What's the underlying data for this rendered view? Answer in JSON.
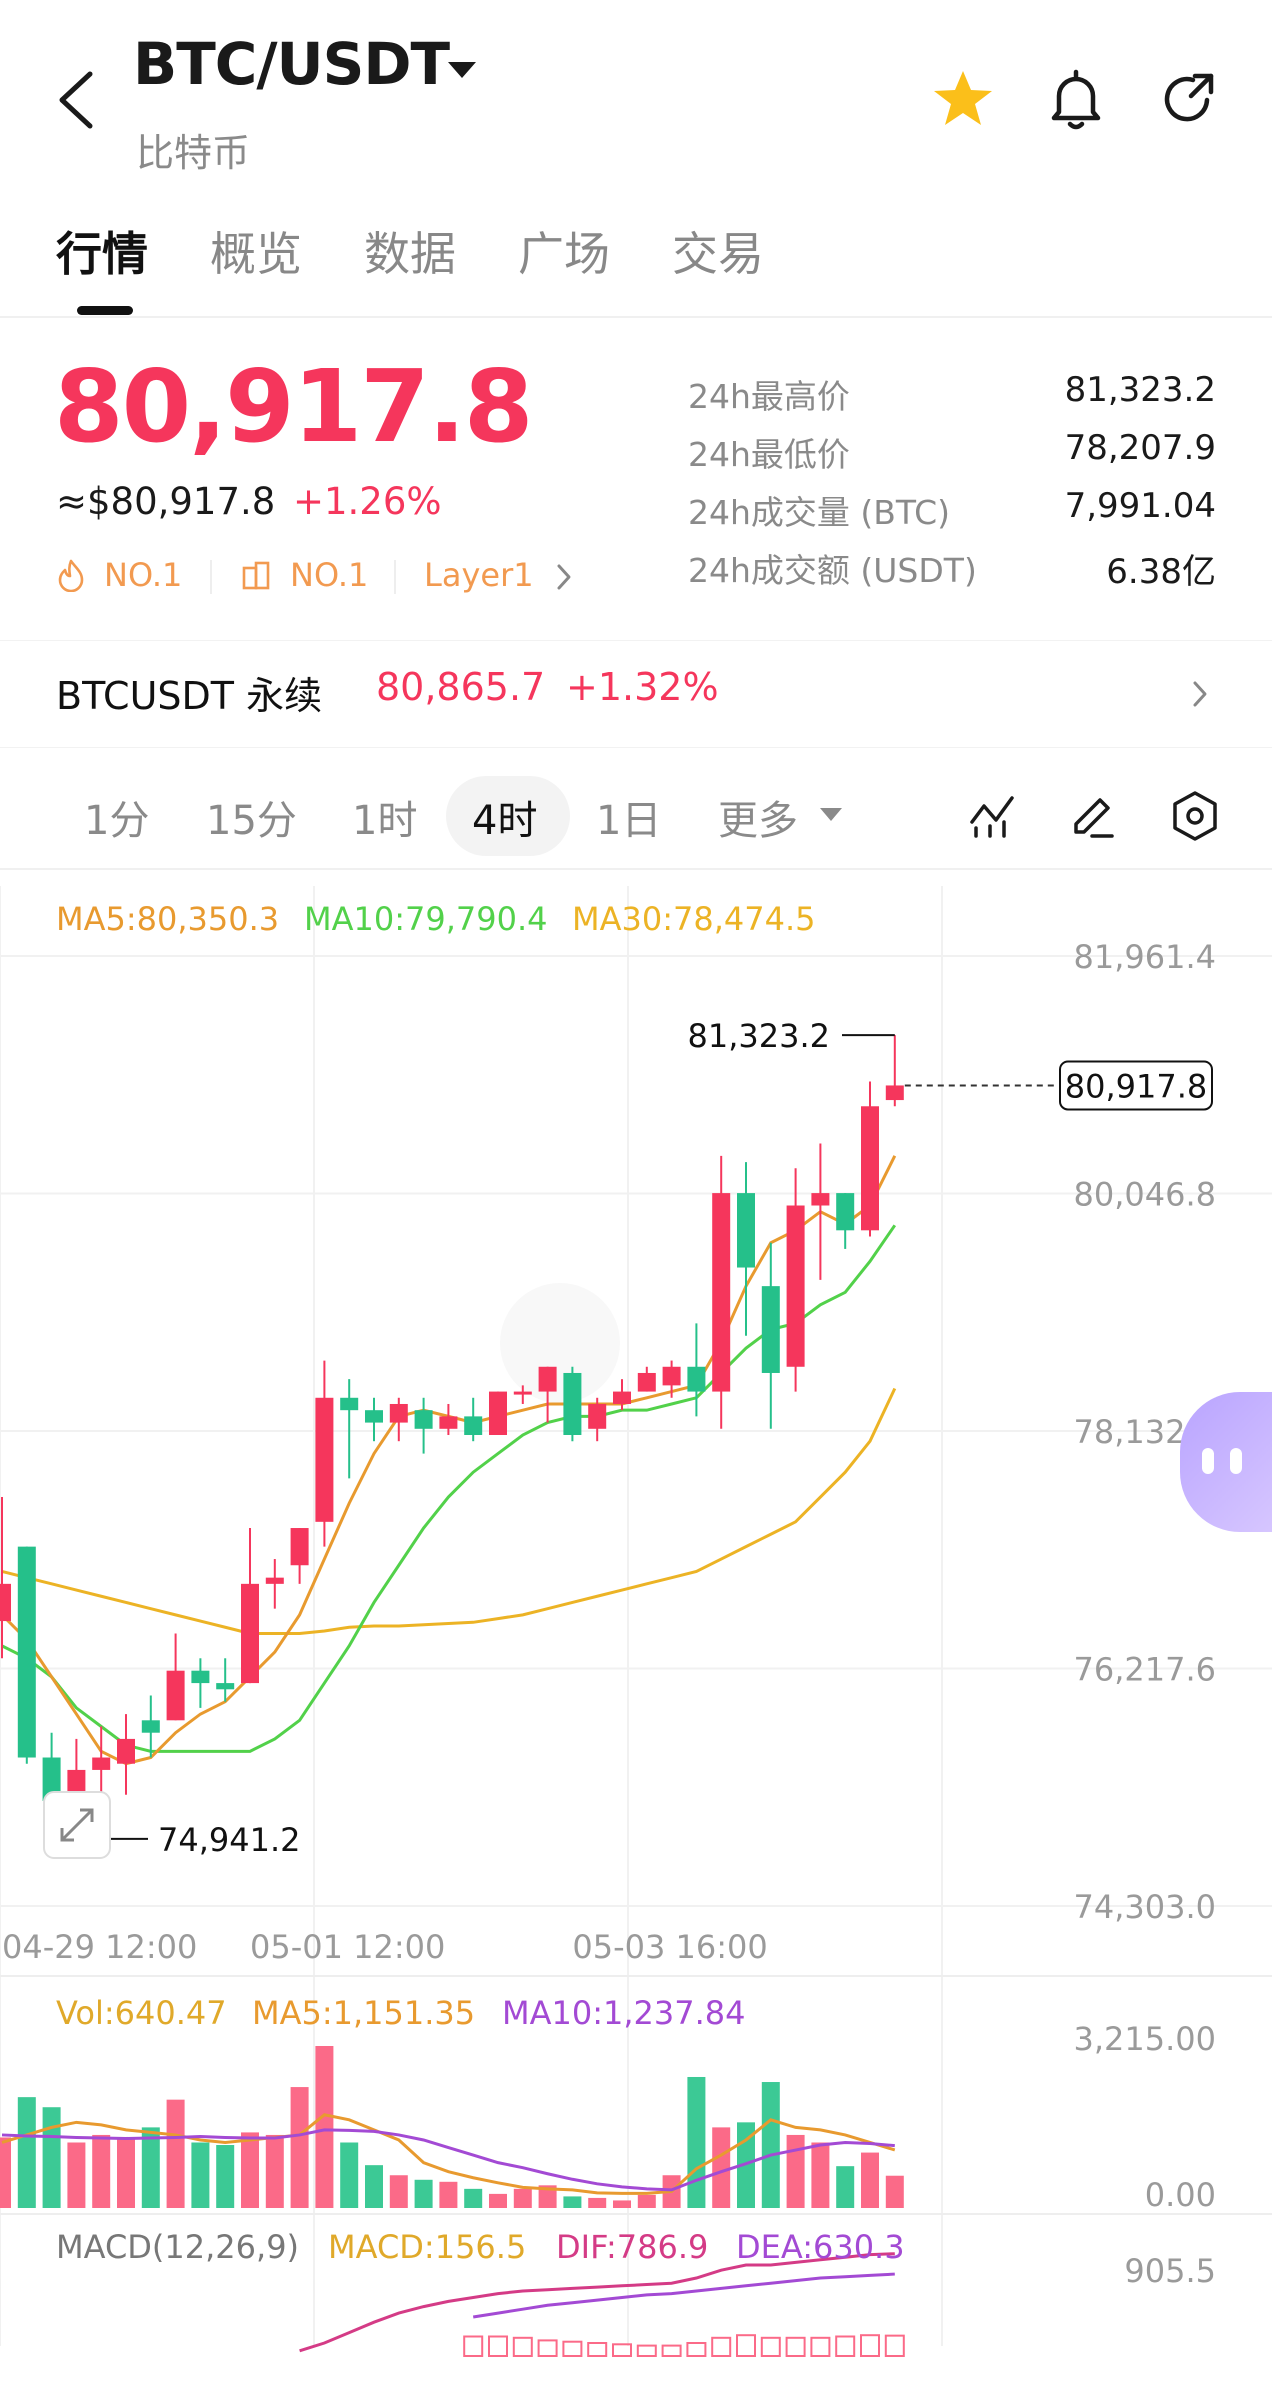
{
  "header": {
    "title": "BTC/USDT",
    "subtitle": "比特币",
    "icons": [
      "back-chevron-icon",
      "star-icon",
      "bell-icon",
      "share-icon"
    ],
    "star_color": "#fbbf1a"
  },
  "tabs": [
    {
      "label": "行情",
      "active": true
    },
    {
      "label": "概览",
      "active": false
    },
    {
      "label": "数据",
      "active": false
    },
    {
      "label": "广场",
      "active": false
    },
    {
      "label": "交易",
      "active": false
    }
  ],
  "price": {
    "last": "80,917.8",
    "usd": "≈$80,917.8",
    "change": "+1.26%",
    "badges": [
      {
        "label": "NO.1",
        "icon": "flame-icon"
      },
      {
        "label": "NO.1",
        "icon": "building-icon"
      },
      {
        "label": "Layer1",
        "icon": ""
      }
    ]
  },
  "stats": [
    {
      "label": "24h最高价",
      "value": "81,323.2"
    },
    {
      "label": "24h最低价",
      "value": "78,207.9"
    },
    {
      "label": "24h成交量 (BTC)",
      "value": "7,991.04"
    },
    {
      "label": "24h成交额 (USDT)",
      "value": "6.38亿"
    }
  ],
  "perp": {
    "name": "BTCUSDT 永续",
    "price": "80,865.7",
    "change": "+1.32%"
  },
  "intervals": {
    "items": [
      "1分",
      "15分",
      "1时",
      "4时",
      "1日"
    ],
    "active": "4时",
    "more": "更多"
  },
  "colors": {
    "up": "#f5365c",
    "down": "#25c08a",
    "ma5": "#e89a2f",
    "ma10": "#52d14a",
    "ma30": "#ecb325",
    "vol_ma10": "#a34ad4",
    "macd_dif": "#d43b86",
    "macd_dea": "#a34ad4"
  },
  "main_chart": {
    "ma_labels": [
      "MA5:80,350.3",
      "MA10:79,790.4",
      "MA30:78,474.5"
    ],
    "y_labels": [
      "81,961.4",
      "80,046.8",
      "78,132.2",
      "76,217.6",
      "74,303.0"
    ],
    "x_labels": [
      "04-29 12:00",
      "05-01 12:00",
      "05-03 16:00"
    ],
    "high_marker": "81,323.2",
    "low_marker": "74,941.2",
    "last_marker": "80,917.8"
  },
  "volume_chart": {
    "labels": [
      "Vol:640.47",
      "MA5:1,151.35",
      "MA10:1,237.84"
    ],
    "y_labels": [
      "3,215.00",
      "0.00"
    ]
  },
  "macd_chart": {
    "labels": [
      "MACD(12,26,9)",
      "MACD:156.5",
      "DIF:786.9",
      "DEA:630.3"
    ],
    "y_label": "905.5"
  },
  "chart_data": {
    "type": "candlestick",
    "interval": "4时",
    "ylim": [
      74303.0,
      81961.4
    ],
    "candles": [
      {
        "o": 76600,
        "h": 77600,
        "l": 76300,
        "c": 76900
      },
      {
        "o": 77200,
        "h": 77200,
        "l": 75450,
        "c": 75500
      },
      {
        "o": 75500,
        "h": 75700,
        "l": 74941.2,
        "c": 75150
      },
      {
        "o": 75150,
        "h": 75650,
        "l": 75150,
        "c": 75400
      },
      {
        "o": 75400,
        "h": 75750,
        "l": 74950,
        "c": 75500
      },
      {
        "o": 75450,
        "h": 75850,
        "l": 75200,
        "c": 75650
      },
      {
        "o": 75800,
        "h": 76000,
        "l": 75500,
        "c": 75700
      },
      {
        "o": 75800,
        "h": 76500,
        "l": 75800,
        "c": 76200
      },
      {
        "o": 76200,
        "h": 76300,
        "l": 75900,
        "c": 76100
      },
      {
        "o": 76100,
        "h": 76300,
        "l": 75950,
        "c": 76050
      },
      {
        "o": 76100,
        "h": 77350,
        "l": 76100,
        "c": 76900
      },
      {
        "o": 76900,
        "h": 77100,
        "l": 76700,
        "c": 76950
      },
      {
        "o": 77050,
        "h": 77350,
        "l": 76900,
        "c": 77350
      },
      {
        "o": 77400,
        "h": 78700,
        "l": 77200,
        "c": 78400
      },
      {
        "o": 78400,
        "h": 78550,
        "l": 77750,
        "c": 78300
      },
      {
        "o": 78300,
        "h": 78400,
        "l": 78050,
        "c": 78200
      },
      {
        "o": 78200,
        "h": 78400,
        "l": 78050,
        "c": 78350
      },
      {
        "o": 78300,
        "h": 78400,
        "l": 77950,
        "c": 78150
      },
      {
        "o": 78150,
        "h": 78350,
        "l": 78100,
        "c": 78250
      },
      {
        "o": 78250,
        "h": 78400,
        "l": 78050,
        "c": 78100
      },
      {
        "o": 78100,
        "h": 78450,
        "l": 78100,
        "c": 78450
      },
      {
        "o": 78450,
        "h": 78500,
        "l": 78350,
        "c": 78450
      },
      {
        "o": 78450,
        "h": 78650,
        "l": 78200,
        "c": 78650
      },
      {
        "o": 78600,
        "h": 78650,
        "l": 78050,
        "c": 78100
      },
      {
        "o": 78150,
        "h": 78400,
        "l": 78050,
        "c": 78350
      },
      {
        "o": 78350,
        "h": 78550,
        "l": 78300,
        "c": 78450
      },
      {
        "o": 78450,
        "h": 78650,
        "l": 78450,
        "c": 78600
      },
      {
        "o": 78500,
        "h": 78700,
        "l": 78400,
        "c": 78650
      },
      {
        "o": 78650,
        "h": 79000,
        "l": 78250,
        "c": 78450
      },
      {
        "o": 78450,
        "h": 80350,
        "l": 78150,
        "c": 80050
      },
      {
        "o": 80050,
        "h": 80300,
        "l": 78900,
        "c": 79450
      },
      {
        "o": 79300,
        "h": 79650,
        "l": 78150,
        "c": 78600
      },
      {
        "o": 78650,
        "h": 80250,
        "l": 78450,
        "c": 79950
      },
      {
        "o": 79950,
        "h": 80450,
        "l": 79350,
        "c": 80050
      },
      {
        "o": 80050,
        "h": 80050,
        "l": 79600,
        "c": 79750
      },
      {
        "o": 79750,
        "h": 80950,
        "l": 79700,
        "c": 80750
      },
      {
        "o": 80800,
        "h": 81323.2,
        "l": 80750,
        "c": 80917.8
      }
    ],
    "ma5": [
      76650,
      76450,
      76150,
      75850,
      75550,
      75450,
      75500,
      75700,
      75850,
      75950,
      76150,
      76350,
      76650,
      77100,
      77550,
      77950,
      78250,
      78300,
      78250,
      78200,
      78250,
      78300,
      78350,
      78350,
      78350,
      78350,
      78400,
      78450,
      78500,
      78850,
      79300,
      79650,
      79750,
      79900,
      79800,
      79950,
      80350.3
    ],
    "ma10": [
      76400,
      76300,
      76150,
      75900,
      75750,
      75600,
      75550,
      75550,
      75550,
      75550,
      75550,
      75650,
      75800,
      76100,
      76400,
      76750,
      77050,
      77350,
      77600,
      77800,
      77950,
      78100,
      78200,
      78250,
      78250,
      78300,
      78300,
      78350,
      78400,
      78600,
      78800,
      78950,
      79000,
      79150,
      79250,
      79500,
      79790.4
    ],
    "ma30": [
      77000,
      76950,
      76900,
      76850,
      76800,
      76750,
      76700,
      76650,
      76600,
      76550,
      76500,
      76500,
      76500,
      76520,
      76550,
      76560,
      76560,
      76570,
      76580,
      76590,
      76620,
      76650,
      76700,
      76750,
      76800,
      76850,
      76900,
      76950,
      77000,
      77100,
      77200,
      77300,
      77400,
      77600,
      77800,
      78050,
      78474.5
    ],
    "volume": [
      1400,
      2200,
      2000,
      1300,
      1450,
      1400,
      1600,
      2150,
      1300,
      1250,
      1500,
      1450,
      2400,
      3215,
      1300,
      850,
      650,
      560,
      520,
      380,
      280,
      380,
      450,
      230,
      200,
      150,
      260,
      650,
      2600,
      1600,
      1700,
      2500,
      1450,
      1300,
      830,
      1100,
      640.47
    ],
    "vol_ma5": [
      1300,
      1450,
      1600,
      1700,
      1650,
      1550,
      1500,
      1450,
      1350,
      1300,
      1350,
      1400,
      1450,
      1850,
      1750,
      1550,
      1350,
      900,
      720,
      600,
      500,
      410,
      380,
      360,
      300,
      290,
      290,
      330,
      780,
      1050,
      1350,
      1750,
      1600,
      1550,
      1450,
      1300,
      1151.35
    ],
    "vol_ma10": [
      1450,
      1430,
      1420,
      1400,
      1390,
      1380,
      1390,
      1400,
      1420,
      1400,
      1390,
      1390,
      1450,
      1550,
      1540,
      1520,
      1450,
      1350,
      1200,
      1050,
      900,
      800,
      680,
      570,
      480,
      420,
      380,
      360,
      550,
      720,
      880,
      1050,
      1150,
      1250,
      1300,
      1280,
      1237.84
    ],
    "macd_dif": [
      null,
      null,
      null,
      null,
      null,
      null,
      null,
      null,
      null,
      null,
      null,
      null,
      40,
      100,
      180,
      260,
      330,
      380,
      420,
      450,
      480,
      500,
      510,
      520,
      530,
      540,
      550,
      560,
      600,
      660,
      700,
      700,
      720,
      740,
      760,
      780,
      786.9
    ],
    "macd_dea": [
      null,
      null,
      null,
      null,
      null,
      null,
      null,
      null,
      null,
      null,
      null,
      null,
      null,
      null,
      null,
      null,
      null,
      null,
      null,
      300,
      330,
      360,
      390,
      410,
      430,
      450,
      470,
      480,
      500,
      520,
      540,
      560,
      580,
      600,
      610,
      620,
      630.3
    ],
    "x_ticks": [
      {
        "index": 0,
        "label": "04-29 12:00"
      },
      {
        "index": 10,
        "label": "05-01 12:00"
      },
      {
        "index": 23,
        "label": "05-03 16:00"
      }
    ]
  }
}
